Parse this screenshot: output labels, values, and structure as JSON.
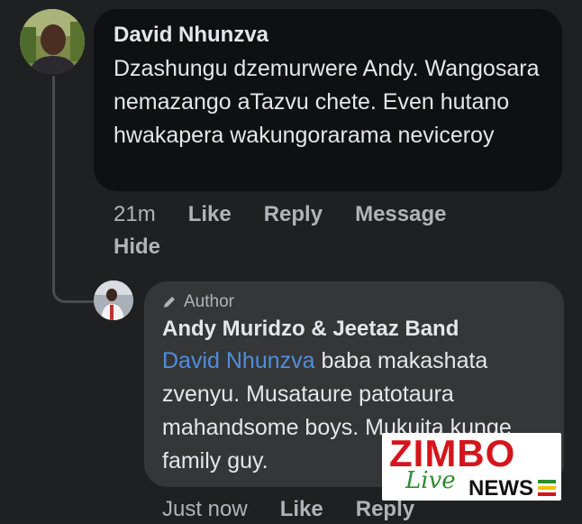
{
  "comments": [
    {
      "author": "David Nhunzva",
      "text": "Dzashungu dzemurwere Andy. Wangosara nemazango aTazvu chete. Even hutano hwakapera wakungorarama neviceroy",
      "actions": {
        "time": "21m",
        "like": "Like",
        "reply": "Reply",
        "message": "Message",
        "hide": "Hide"
      }
    },
    {
      "badge": "Author",
      "author": "Andy Muridzo & Jeetaz Band",
      "mention": "David Nhunzva",
      "text": " baba makashata zvenyu. Musataure patotaura mahandsome boys. Mukuita kunge family guy.",
      "actions": {
        "time": "Just now",
        "like": "Like",
        "reply": "Reply"
      }
    }
  ],
  "watermark": {
    "brand": "ZIMBO",
    "tagline": "Live",
    "suffix": "NEWS"
  },
  "colors": {
    "background": "#1f2022",
    "bubble_dark": "#0f1012",
    "bubble_reply": "#353638",
    "mention": "#4f8edc",
    "muted": "#b0b3b8",
    "brand_red": "#d6141c",
    "brand_green": "#2b8d2e"
  },
  "icons": [
    "avatar",
    "pencil-icon"
  ]
}
